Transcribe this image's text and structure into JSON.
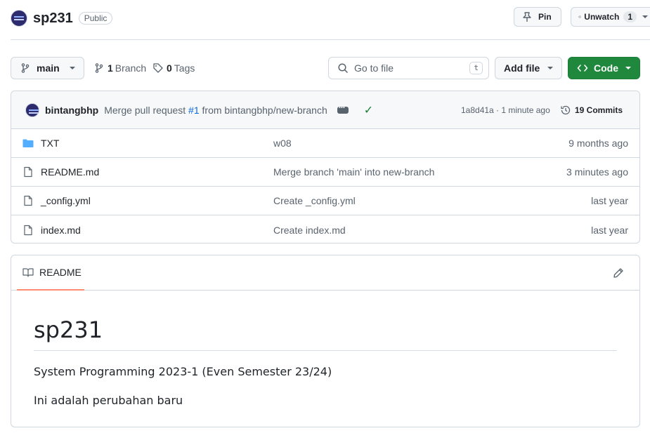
{
  "repo": {
    "name": "sp231",
    "visibility": "Public"
  },
  "header_actions": {
    "pin_label": "Pin",
    "watch_label": "Unwatch",
    "watch_count": "1"
  },
  "toolbar": {
    "branch": "main",
    "branch_count": "1",
    "branch_label": "Branch",
    "tag_count": "0",
    "tag_label": "Tags",
    "search_placeholder": "Go to file",
    "search_shortcut": "t",
    "add_file_label": "Add file",
    "code_label": "Code"
  },
  "latest_commit": {
    "author": "bintangbhp",
    "message_prefix": "Merge pull request",
    "pr_ref": "#1",
    "message_suffix": "from bintangbhp/new-branch",
    "hash_time": "1a8d41a · 1 minute ago",
    "commit_count_label": "19 Commits"
  },
  "files": [
    {
      "name": "TXT",
      "type": "folder",
      "commit": "w08",
      "age": "9 months ago"
    },
    {
      "name": "README.md",
      "type": "file",
      "commit": "Merge branch 'main' into new-branch",
      "age": "3 minutes ago"
    },
    {
      "name": "_config.yml",
      "type": "file",
      "commit": "Create _config.yml",
      "age": "last year"
    },
    {
      "name": "index.md",
      "type": "file",
      "commit": "Create index.md",
      "age": "last year"
    }
  ],
  "readme": {
    "tab_label": "README",
    "title": "sp231",
    "paragraph1": "System Programming 2023-1 (Even Semester 23/24)",
    "paragraph2": "Ini adalah perubahan baru"
  },
  "colors": {
    "code_button": "#1f883d",
    "link": "#0969da",
    "success": "#1a7f37",
    "folder": "#54aeff",
    "tab_underline": "#fd8c73"
  }
}
